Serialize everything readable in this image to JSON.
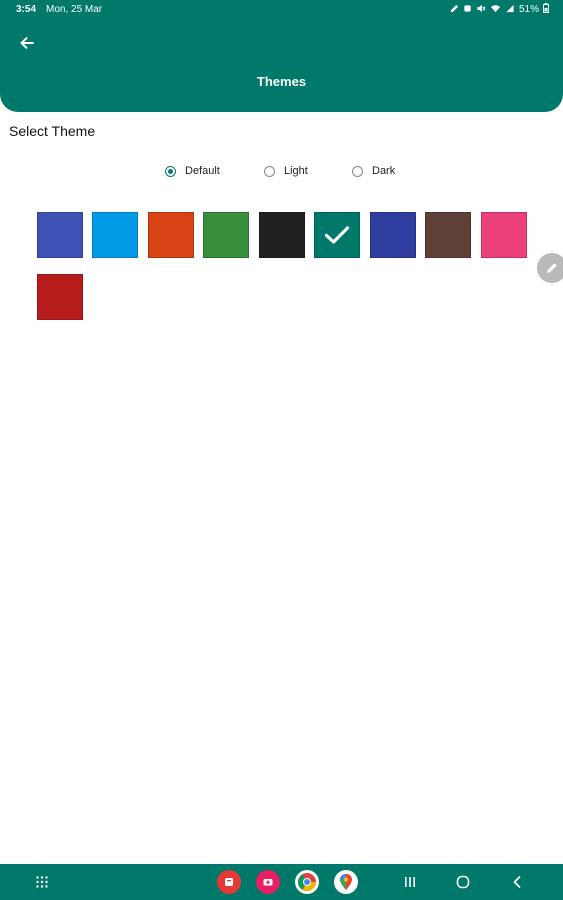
{
  "status_bar": {
    "time": "3:54",
    "date": "Mon, 25 Mar",
    "battery": "51%"
  },
  "header": {
    "title": "Themes",
    "back_icon": "arrow-left-icon"
  },
  "section": {
    "title": "Select Theme"
  },
  "theme_options": [
    {
      "label": "Default",
      "selected": true
    },
    {
      "label": "Light",
      "selected": false
    },
    {
      "label": "Dark",
      "selected": false
    }
  ],
  "swatches": [
    {
      "color": "#3F51B5",
      "selected": false
    },
    {
      "color": "#039BE5",
      "selected": false
    },
    {
      "color": "#D84315",
      "selected": false
    },
    {
      "color": "#388E3C",
      "selected": false
    },
    {
      "color": "#212121",
      "selected": false
    },
    {
      "color": "#00796B",
      "selected": true
    },
    {
      "color": "#303F9F",
      "selected": false
    },
    {
      "color": "#5D4037",
      "selected": false
    },
    {
      "color": "#EC407A",
      "selected": false
    },
    {
      "color": "#B71C1C",
      "selected": false
    }
  ],
  "colors": {
    "primary": "#00796B",
    "background": "#FFFFFF"
  },
  "nav_bar": {
    "items": [
      "apps-grid-icon",
      "red-app-icon",
      "pink-app-icon",
      "chrome-icon",
      "maps-icon",
      "recents-icon",
      "home-icon",
      "back-icon"
    ]
  }
}
